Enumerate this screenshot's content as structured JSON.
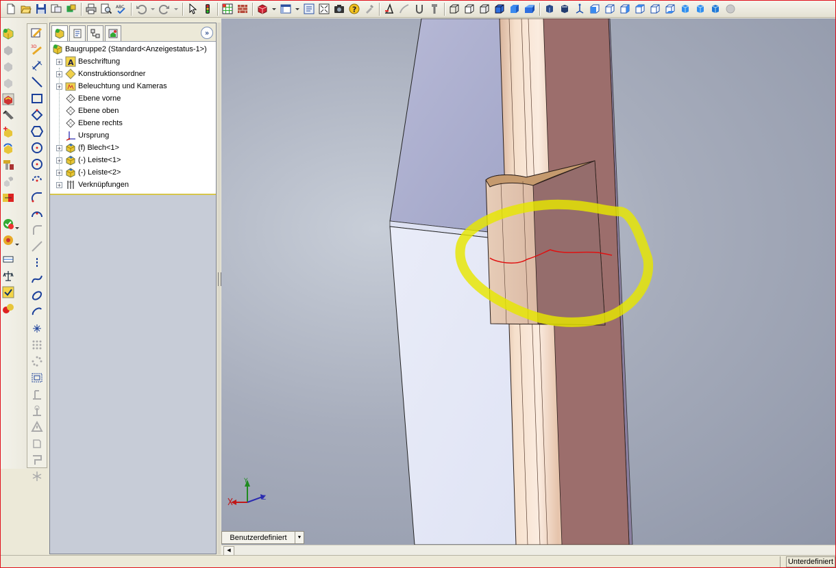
{
  "toolbar": {
    "icons": [
      "new-document",
      "open-folder",
      "save",
      "print-preview",
      "options",
      "print",
      "zoom-print-preview",
      "spell-check",
      "undo",
      "undo-dropdown",
      "redo",
      "redo-dropdown",
      "select-pointer",
      "traffic-light",
      "grid",
      "rebuild",
      "view-3d",
      "view-dropdown",
      "section-window",
      "view-orientation",
      "zoom-fit",
      "camera",
      "help",
      "tool",
      "measure",
      "sketch",
      "mass",
      "orient",
      "screw",
      "wireframe",
      "hidden-lines",
      "hidden-visible",
      "shaded-edges",
      "shaded",
      "perspective",
      "view-cube-1",
      "view-cube-2",
      "axis",
      "view-front",
      "view-back",
      "view-left",
      "view-right",
      "view-top",
      "view-bottom",
      "view-iso",
      "view-trimetric",
      "view-dimetric",
      "disabled-sphere"
    ]
  },
  "feature_manager": {
    "tabs": [
      "featuremanager-tab",
      "propertymanager-tab",
      "configurationmanager-tab",
      "display-manager-tab"
    ],
    "expand_label": "»",
    "tree": [
      {
        "label": "Baugruppe2  (Standard<Anzeigestatus-1>)",
        "icon": "assembly-icon",
        "expandable": false,
        "root": true
      },
      {
        "label": "Beschriftung",
        "icon": "annotation-icon",
        "expandable": true
      },
      {
        "label": "Konstruktionsordner",
        "icon": "design-folder-icon",
        "expandable": true
      },
      {
        "label": "Beleuchtung und Kameras",
        "icon": "lights-cameras-icon",
        "expandable": true
      },
      {
        "label": "Ebene vorne",
        "icon": "plane-icon",
        "expandable": false
      },
      {
        "label": "Ebene oben",
        "icon": "plane-icon",
        "expandable": false
      },
      {
        "label": "Ebene rechts",
        "icon": "plane-icon",
        "expandable": false
      },
      {
        "label": "Ursprung",
        "icon": "origin-icon",
        "expandable": false
      },
      {
        "label": "(f) Blech<1>",
        "icon": "part-icon",
        "expandable": true
      },
      {
        "label": "(-) Leiste<1>",
        "icon": "part-icon",
        "expandable": true
      },
      {
        "label": "(-) Leiste<2>",
        "icon": "part-icon",
        "expandable": true
      },
      {
        "label": "Verknüpfungen",
        "icon": "mates-icon",
        "expandable": true
      }
    ]
  },
  "viewport": {
    "triad": {
      "y_label": "Y",
      "z_label": "Z"
    },
    "highlight_color": "#e6e600",
    "annotation_color": "#e01010"
  },
  "view_tab": {
    "label": "Benutzerdefiniert"
  },
  "statusbar": {
    "state": "Unterdefiniert"
  }
}
